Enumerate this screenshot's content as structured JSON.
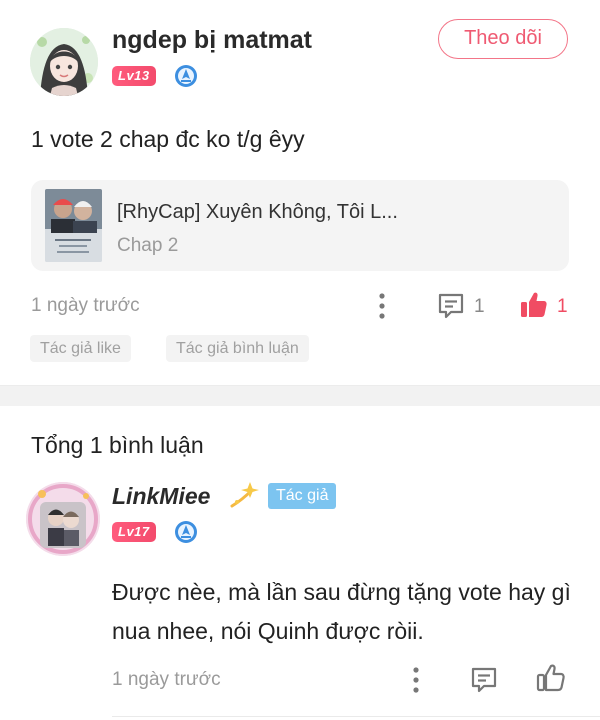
{
  "post": {
    "username": "ngdep bị matmat",
    "level": "Lv13",
    "follow_label": "Theo dõi",
    "text": "1 vote 2 chap đc ko t/g êyy",
    "comic": {
      "title": "[RhyCap] Xuyên Không, Tôi L...",
      "chapter": "Chap 2"
    },
    "time": "1 ngày trước",
    "reply_count": "1",
    "like_count": "1",
    "tags": [
      "Tác giả like",
      "Tác giả bình luận"
    ]
  },
  "comments": {
    "total": "Tổng 1 bình luận",
    "items": [
      {
        "username": "LinkMiee",
        "author_badge": "Tác giả",
        "level": "Lv17",
        "text": "Được nèe, mà lần sau đừng tặng vote hay gì nua nhee, nói Quinh được ròii.",
        "time": "1 ngày trước"
      }
    ]
  },
  "colors": {
    "accent_pink": "#ef5a72",
    "author_badge_blue": "#7cc4f0",
    "level_badge_red": "#f34b6c",
    "muted_text": "#9a9a9a"
  },
  "icons": [
    "rank-icon",
    "more-vertical-icon",
    "comment-icon",
    "thumbs-up-filled-icon",
    "thumbs-up-outline-icon",
    "sparkle-icon"
  ]
}
